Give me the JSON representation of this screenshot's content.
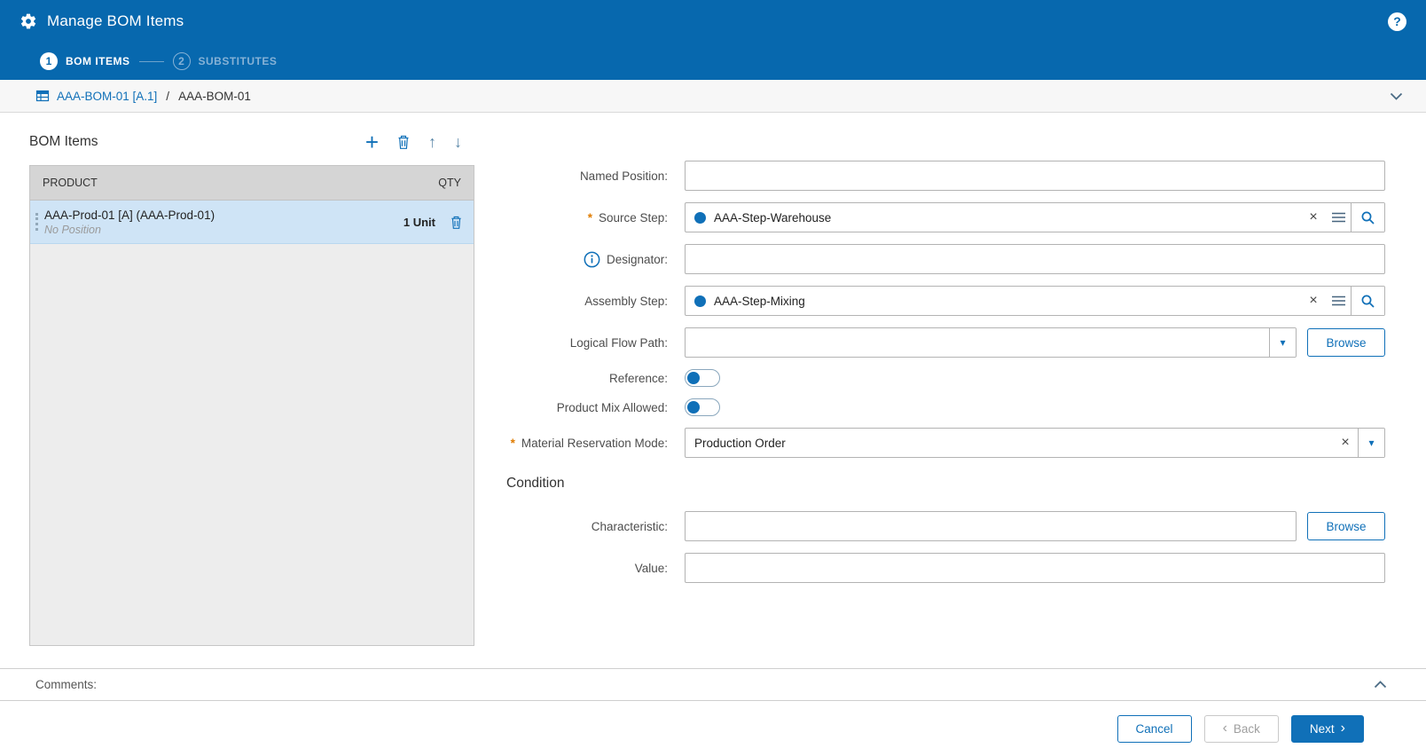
{
  "colors": {
    "header_bg": "#0768ae",
    "accent": "#1070b8",
    "selected_row": "#cfe4f6"
  },
  "header": {
    "title": "Manage BOM Items",
    "help": "?"
  },
  "wizard": {
    "steps": [
      {
        "number": "1",
        "label": "BOM ITEMS"
      },
      {
        "number": "2",
        "label": "SUBSTITUTES"
      }
    ]
  },
  "breadcrumb": {
    "link": "AAA-BOM-01 [A.1]",
    "separator": "/",
    "current": "AAA-BOM-01"
  },
  "bom_items": {
    "title": "BOM Items",
    "columns": {
      "product": "PRODUCT",
      "qty": "QTY"
    },
    "rows": [
      {
        "product": "AAA-Prod-01 [A] (AAA-Prod-01)",
        "position": "No Position",
        "qty": "1 Unit"
      }
    ]
  },
  "form": {
    "required_marker": "*",
    "named_position_label": "Named Position:",
    "source_step_label": "Source Step:",
    "source_step_value": "AAA-Step-Warehouse",
    "designator_label": "Designator:",
    "assembly_step_label": "Assembly Step:",
    "assembly_step_value": "AAA-Step-Mixing",
    "logical_flow_path_label": "Logical Flow Path:",
    "browse_label": "Browse",
    "reference_label": "Reference:",
    "product_mix_label": "Product Mix Allowed:",
    "material_reservation_label": "Material Reservation Mode:",
    "material_reservation_value": "Production Order",
    "condition_title": "Condition",
    "characteristic_label": "Characteristic:",
    "value_label": "Value:"
  },
  "comments": {
    "label": "Comments:"
  },
  "footer": {
    "cancel": "Cancel",
    "back": "Back",
    "next": "Next"
  },
  "icons": {
    "plus": "+",
    "arrow_up": "↑",
    "arrow_down": "↓",
    "clear": "×",
    "caret_down": "▾",
    "back_chevron": "‹",
    "next_chevron": "›"
  }
}
